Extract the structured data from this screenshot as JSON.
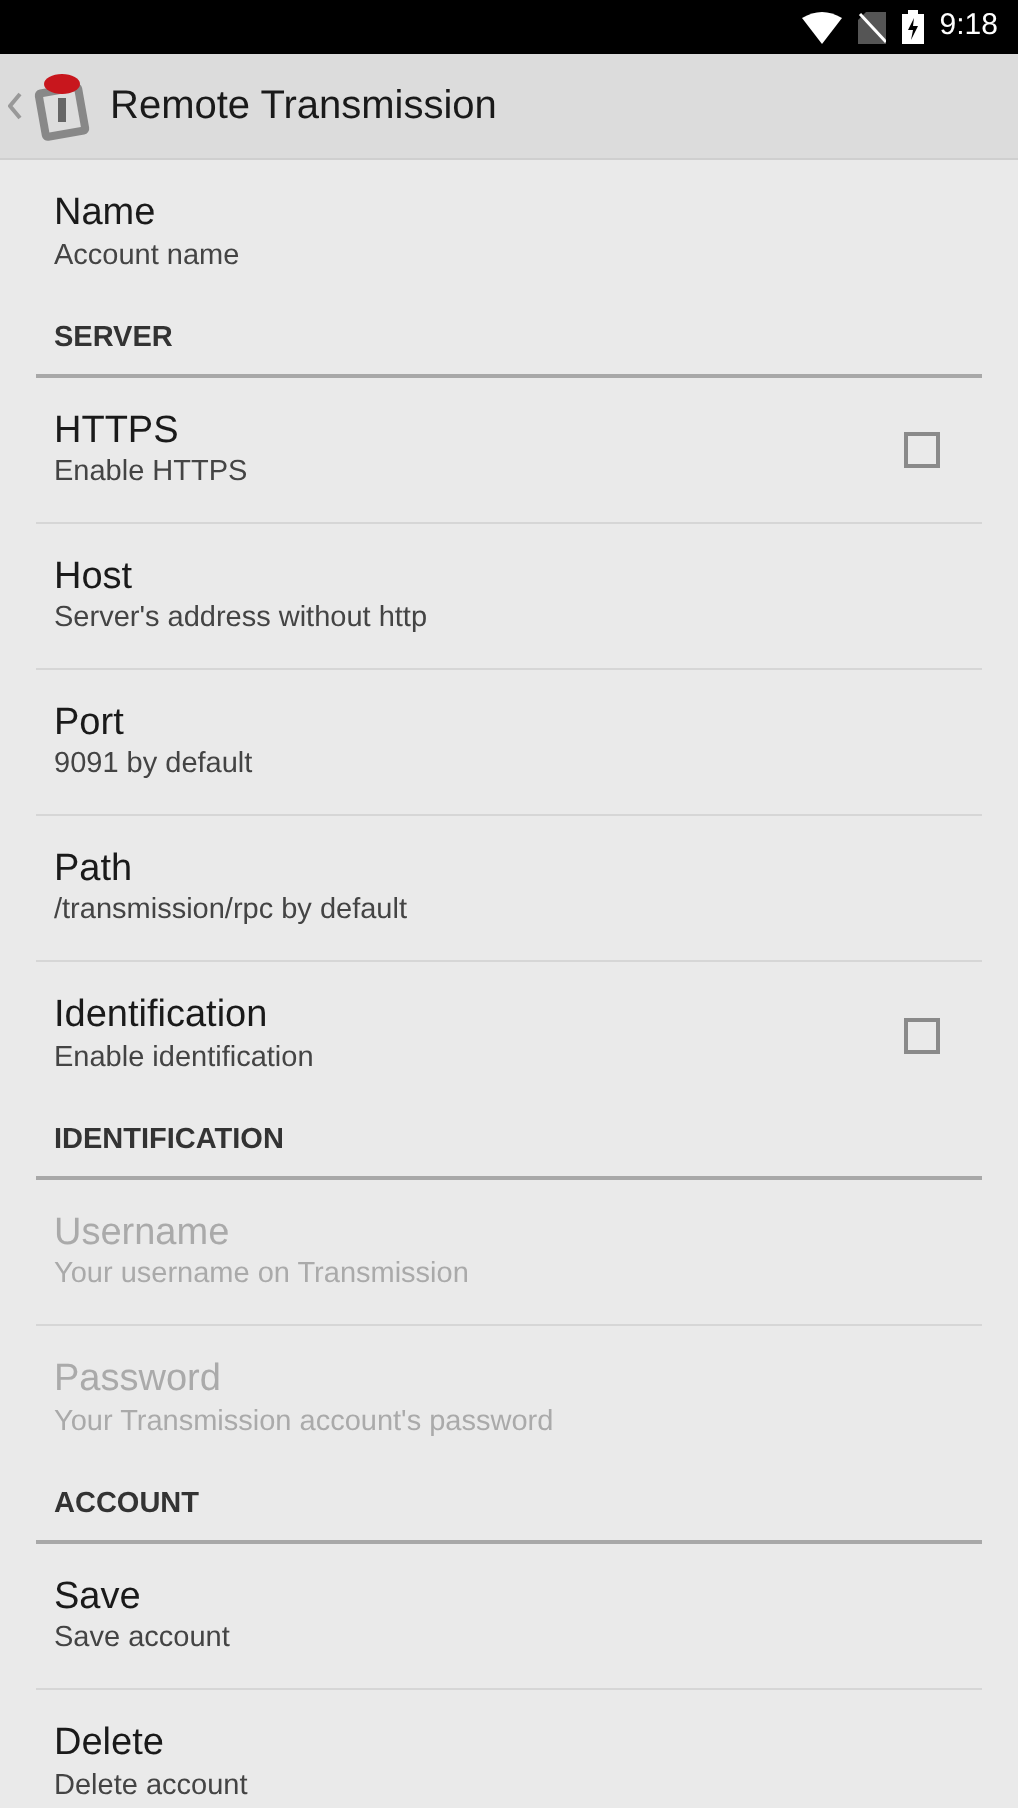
{
  "status_bar": {
    "time": "9:18"
  },
  "app_bar": {
    "title": "Remote Transmission"
  },
  "items": [
    {
      "kind": "text",
      "title": "Name",
      "summary": "Account name",
      "disabled": false
    },
    {
      "kind": "category",
      "title": "SERVER"
    },
    {
      "kind": "checkbox",
      "title": "HTTPS",
      "summary": "Enable HTTPS",
      "disabled": false,
      "checked": false
    },
    {
      "kind": "text",
      "title": "Host",
      "summary": "Server's address without http",
      "disabled": false
    },
    {
      "kind": "text",
      "title": "Port",
      "summary": "9091 by default",
      "disabled": false
    },
    {
      "kind": "text",
      "title": "Path",
      "summary": "/transmission/rpc by default",
      "disabled": false
    },
    {
      "kind": "checkbox",
      "title": "Identification",
      "summary": "Enable identification",
      "disabled": false,
      "checked": false
    },
    {
      "kind": "category",
      "title": "IDENTIFICATION"
    },
    {
      "kind": "text",
      "title": "Username",
      "summary": "Your username on Transmission",
      "disabled": true
    },
    {
      "kind": "text",
      "title": "Password",
      "summary": "Your Transmission account's password",
      "disabled": true
    },
    {
      "kind": "category",
      "title": "ACCOUNT"
    },
    {
      "kind": "text",
      "title": "Save",
      "summary": "Save account",
      "disabled": false
    },
    {
      "kind": "text",
      "title": "Delete",
      "summary": "Delete account",
      "disabled": false
    }
  ]
}
